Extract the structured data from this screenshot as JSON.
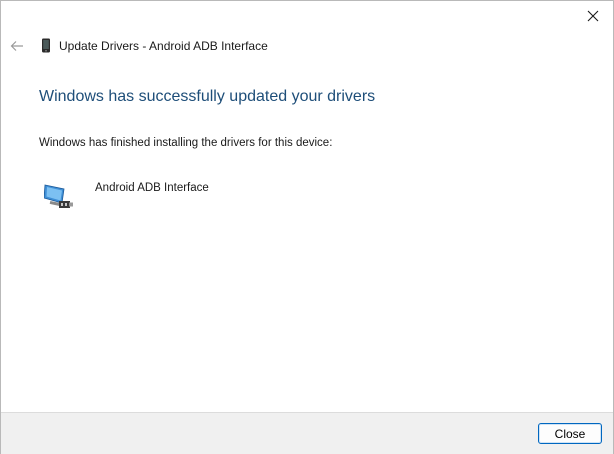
{
  "window": {
    "title": "Update Drivers - Android ADB Interface"
  },
  "content": {
    "heading": "Windows has successfully updated your drivers",
    "description": "Windows has finished installing the drivers for this device:",
    "device_name": "Android ADB Interface"
  },
  "footer": {
    "close_label": "Close"
  },
  "colors": {
    "heading": "#1e4e79",
    "button_border": "#0067c0",
    "footer_bg": "#f0f0f0"
  },
  "icons": {
    "back": "arrow-left-icon",
    "window_close": "close-icon",
    "title_device": "phone-icon",
    "device": "usb-device-icon"
  }
}
